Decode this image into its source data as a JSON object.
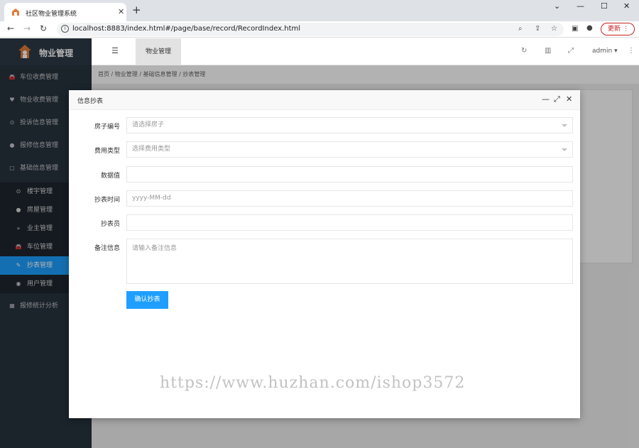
{
  "browser": {
    "tab_title": "社区物业管理系统",
    "url": "localhost:8883/index.html#/page/base/record/RecordIndex.html",
    "update_label": "更新"
  },
  "app": {
    "brand": "物业管理",
    "top_tab": "物业管理",
    "user": "admin"
  },
  "sidebar": {
    "items": [
      {
        "label": "车位收费管理",
        "icon": "car-icon"
      },
      {
        "label": "物业收费管理",
        "icon": "heart-icon"
      },
      {
        "label": "投诉信息管理",
        "icon": "circle-dot-icon"
      },
      {
        "label": "报修信息管理",
        "icon": "wrench-icon"
      },
      {
        "label": "基础信息管理",
        "icon": "cube-icon"
      }
    ],
    "subitems": [
      {
        "label": "楼宇管理",
        "icon": "circle-dot-icon"
      },
      {
        "label": "房屋管理",
        "icon": "dot-icon"
      },
      {
        "label": "业主管理",
        "icon": "chevron-icon"
      },
      {
        "label": "车位管理",
        "icon": "car-icon"
      },
      {
        "label": "抄表管理",
        "icon": "edit-icon"
      },
      {
        "label": "用户管理",
        "icon": "user-icon"
      }
    ],
    "bottom_item": {
      "label": "报修统计分析",
      "icon": "chart-icon"
    }
  },
  "breadcrumb": "首页 / 物业管理 / 基础信息管理 / 抄表管理",
  "modal": {
    "title": "信息抄表",
    "fields": {
      "house_label": "房子编号",
      "house_placeholder": "请选择房子",
      "type_label": "费用类型",
      "type_placeholder": "选择费用类型",
      "value_label": "数据值",
      "time_label": "抄表时间",
      "time_placeholder": "yyyy-MM-dd",
      "reader_label": "抄表员",
      "remarks_label": "备注信息",
      "remarks_placeholder": "请输入备注信息"
    },
    "submit_label": "确认抄表"
  },
  "watermark": "https://www.huzhan.com/ishop3572"
}
